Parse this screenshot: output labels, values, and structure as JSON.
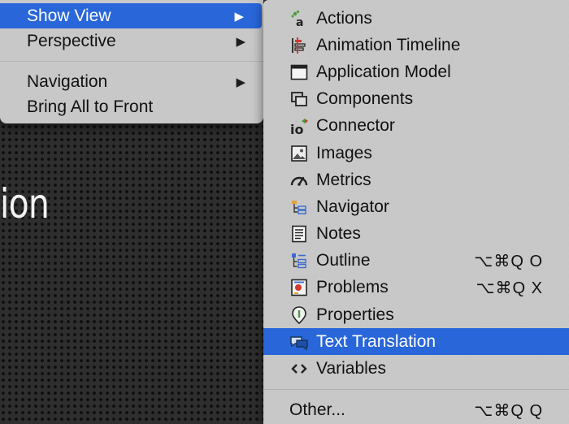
{
  "background": {
    "partial_text": "ion"
  },
  "main_menu": {
    "items": [
      {
        "label": "Show View",
        "has_submenu": true,
        "selected": true
      },
      {
        "label": "Perspective",
        "has_submenu": true
      },
      {
        "label": "Navigation",
        "has_submenu": true
      },
      {
        "label": "Bring All to Front"
      }
    ],
    "arrow_glyph": "▶"
  },
  "sub_menu": {
    "items": [
      {
        "label": "Actions",
        "icon": "actions-icon"
      },
      {
        "label": "Animation Timeline",
        "icon": "animation-timeline-icon"
      },
      {
        "label": "Application Model",
        "icon": "application-model-icon"
      },
      {
        "label": "Components",
        "icon": "components-icon"
      },
      {
        "label": "Connector",
        "icon": "connector-icon"
      },
      {
        "label": "Images",
        "icon": "images-icon"
      },
      {
        "label": "Metrics",
        "icon": "metrics-icon"
      },
      {
        "label": "Navigator",
        "icon": "navigator-icon"
      },
      {
        "label": "Notes",
        "icon": "notes-icon"
      },
      {
        "label": "Outline",
        "icon": "outline-icon",
        "shortcut": "⌥⌘Q O"
      },
      {
        "label": "Problems",
        "icon": "problems-icon",
        "shortcut": "⌥⌘Q X"
      },
      {
        "label": "Properties",
        "icon": "properties-icon"
      },
      {
        "label": "Text Translation",
        "icon": "text-translation-icon",
        "selected": true
      },
      {
        "label": "Variables",
        "icon": "variables-icon"
      }
    ],
    "other": {
      "label": "Other...",
      "shortcut": "⌥⌘Q Q"
    }
  },
  "colors": {
    "highlight": "#2866d9",
    "menu_bg": "#cdcdcd",
    "text": "#111111"
  }
}
